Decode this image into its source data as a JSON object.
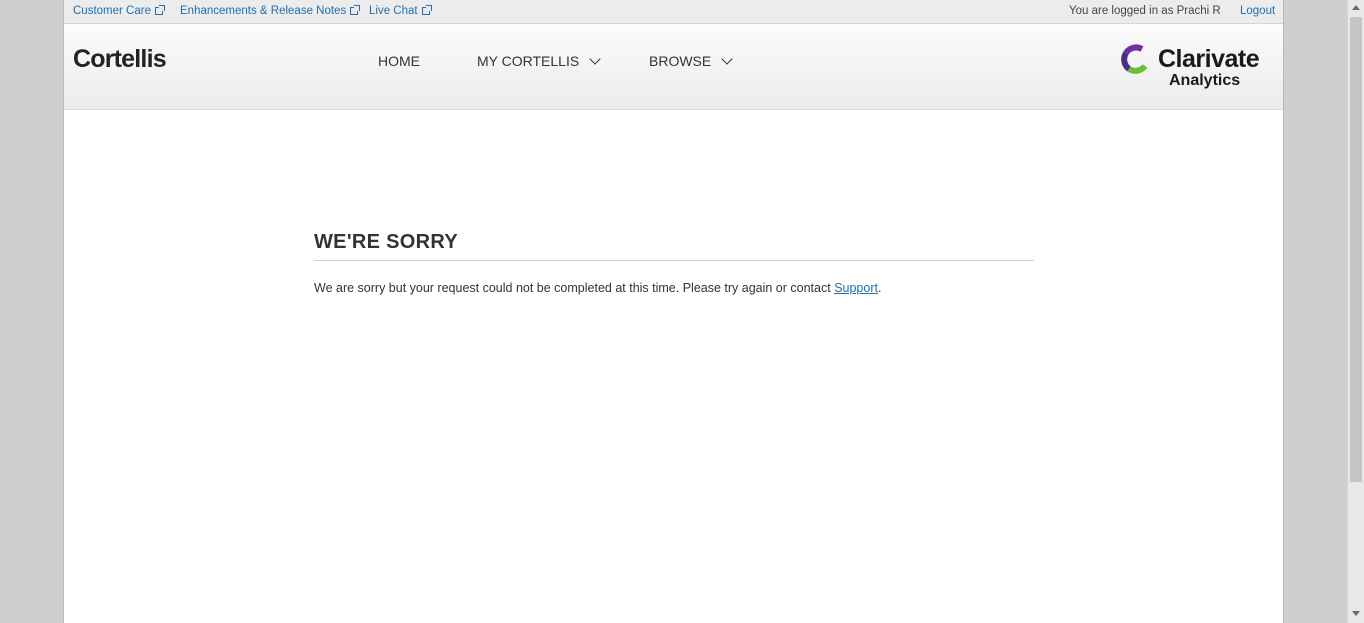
{
  "utility": {
    "links": [
      "Customer Care",
      "Enhancements & Release Notes",
      "Live Chat"
    ],
    "logged_in_text": "You are logged in as Prachi R",
    "logout": "Logout"
  },
  "header": {
    "brand": "Cortellis",
    "nav": [
      "HOME",
      "MY CORTELLIS",
      "BROWSE"
    ],
    "logo_line1": "Clarivate",
    "logo_line2": "Analytics"
  },
  "error": {
    "title": "WE'RE SORRY",
    "message": "We are sorry but your request could not be completed at this time. Please try again or contact ",
    "link": "Support",
    "suffix": "."
  },
  "colors": {
    "link": "#1f6fb2",
    "logo_purple": "#6b2fa0",
    "logo_green": "#6abf2e"
  },
  "icons": [
    "external-link-icon",
    "chevron-down-icon",
    "clarivate-logo-icon"
  ]
}
